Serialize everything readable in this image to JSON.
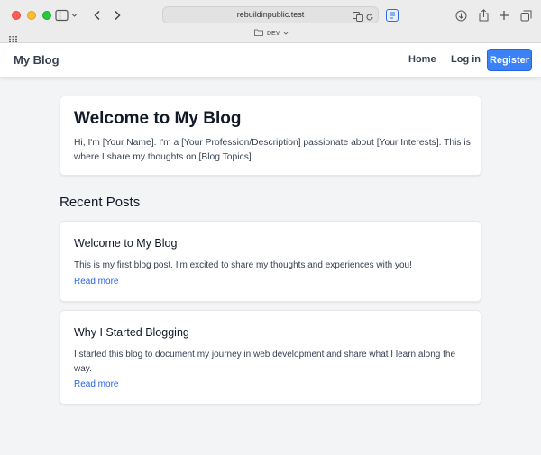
{
  "browser": {
    "address": "rebuildinpublic.test",
    "tab_group": "DEV"
  },
  "nav": {
    "brand": "My Blog",
    "home": "Home",
    "login": "Log in",
    "register": "Register"
  },
  "hero": {
    "title": "Welcome to My Blog",
    "intro": "Hi, I'm [Your Name]. I'm a [Your Profession/Description] passionate about [Your Interests]. This is where I share my thoughts on [Blog Topics]."
  },
  "recent": {
    "heading": "Recent Posts",
    "posts": [
      {
        "title": "Welcome to My Blog",
        "excerpt": "This is my first blog post. I'm excited to share my thoughts and experiences with you!",
        "link": "Read more"
      },
      {
        "title": "Why I Started Blogging",
        "excerpt": "I started this blog to document my journey in web development and share what I learn along the way.",
        "link": "Read more"
      }
    ]
  },
  "colors": {
    "accent": "#3b82f6",
    "link": "#2563eb",
    "page_bg": "#f3f4f6"
  }
}
